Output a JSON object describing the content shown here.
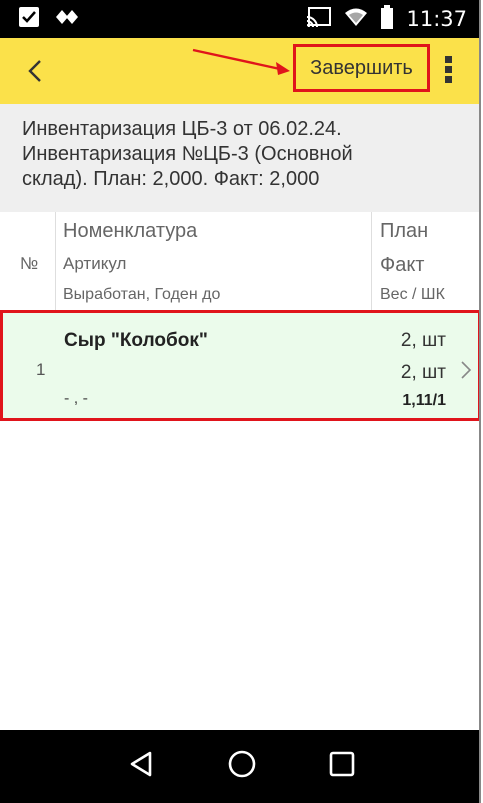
{
  "status_bar": {
    "time": "11:37",
    "left_icons": [
      "checkbox-icon",
      "diamond-icon"
    ],
    "right_icons": [
      "cast-icon",
      "wifi-icon",
      "battery-icon"
    ]
  },
  "app_bar": {
    "finish_label": "Завершить",
    "icons": [
      "back-chevron-icon",
      "more-vertical-icon"
    ]
  },
  "doc": {
    "line1": "Инвентаризация ЦБ-3 от 06.02.24.",
    "line2": "Инвентаризация №ЦБ-3 (Основной",
    "line3": "склад). План: 2,000. Факт: 2,000"
  },
  "columns": {
    "num": "№",
    "nomenclature": "Номенклатура",
    "article": "Артикул",
    "dates": "Выработан, Годен до",
    "plan": "План",
    "fact": "Факт",
    "weight": "Вес / ШК"
  },
  "rows": [
    {
      "num": "1",
      "name": "Сыр \"Колобок\"",
      "article": "",
      "dates": "- , -",
      "plan": "2, шт",
      "fact": "2, шт",
      "weight": "1,11/1"
    }
  ],
  "colors": {
    "app_bar": "#fbe14a",
    "highlight": "#e0141b",
    "row_bg": "#ebfbeb"
  }
}
